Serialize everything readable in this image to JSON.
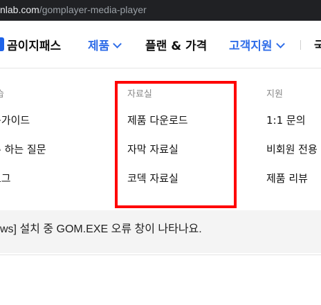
{
  "browser": {
    "url_host": "nlab.com",
    "url_path": "/gomplayer-media-player"
  },
  "header": {
    "logo_text": "곰이지패스",
    "nav": [
      {
        "label": "제품",
        "has_dropdown": true,
        "color": "#2f6de8"
      },
      {
        "label": "플랜 & 가격",
        "has_dropdown": false
      },
      {
        "label": "고객지원",
        "has_dropdown": true,
        "color": "#2f6de8"
      },
      {
        "label": "국"
      }
    ]
  },
  "dropdown": {
    "columns": [
      {
        "title": "습",
        "items": [
          "용가이드",
          "주 하는 질문",
          "로그"
        ]
      },
      {
        "title": "자료실",
        "items": [
          "제품 다운로드",
          "자막 자료실",
          "코덱 자료실"
        ]
      },
      {
        "title": "지원",
        "items": [
          "1:1 문의",
          "비회원 전용",
          "제품 리뷰"
        ]
      }
    ]
  },
  "content": {
    "notice": "ws] 설치 중 GOM.EXE 오류 창이 나타나요."
  },
  "colors": {
    "accent": "#2f6de8",
    "highlight": "#ff0000"
  }
}
